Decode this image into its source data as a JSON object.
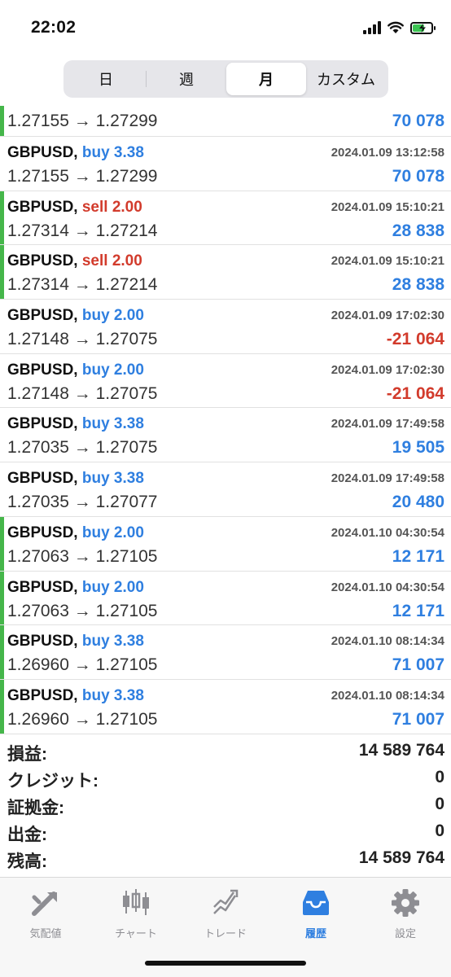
{
  "status": {
    "time": "22:02"
  },
  "segments": [
    "日",
    "週",
    "月",
    "カスタム"
  ],
  "first_row": {
    "prices": "1.27155 → 1.27299",
    "profit": "70 078",
    "profit_color": "#2f7fe0",
    "bar_color": "#45b64a"
  },
  "trades": [
    {
      "symbol": "GBPUSD,",
      "side": "buy 3.38",
      "side_color": "#2f7fe0",
      "time": "2024.01.09 13:12:58",
      "prices": "1.27155 → 1.27299",
      "profit": "70 078",
      "profit_color": "#2f7fe0",
      "bar_color": ""
    },
    {
      "symbol": "GBPUSD,",
      "side": "sell 2.00",
      "side_color": "#d23b2c",
      "time": "2024.01.09 15:10:21",
      "prices": "1.27314 → 1.27214",
      "profit": "28 838",
      "profit_color": "#2f7fe0",
      "bar_color": "#45b64a"
    },
    {
      "symbol": "GBPUSD,",
      "side": "sell 2.00",
      "side_color": "#d23b2c",
      "time": "2024.01.09 15:10:21",
      "prices": "1.27314 → 1.27214",
      "profit": "28 838",
      "profit_color": "#2f7fe0",
      "bar_color": "#45b64a"
    },
    {
      "symbol": "GBPUSD,",
      "side": "buy 2.00",
      "side_color": "#2f7fe0",
      "time": "2024.01.09 17:02:30",
      "prices": "1.27148 → 1.27075",
      "profit": "-21 064",
      "profit_color": "#d23b2c",
      "bar_color": ""
    },
    {
      "symbol": "GBPUSD,",
      "side": "buy 2.00",
      "side_color": "#2f7fe0",
      "time": "2024.01.09 17:02:30",
      "prices": "1.27148 → 1.27075",
      "profit": "-21 064",
      "profit_color": "#d23b2c",
      "bar_color": ""
    },
    {
      "symbol": "GBPUSD,",
      "side": "buy 3.38",
      "side_color": "#2f7fe0",
      "time": "2024.01.09 17:49:58",
      "prices": "1.27035 → 1.27075",
      "profit": "19 505",
      "profit_color": "#2f7fe0",
      "bar_color": ""
    },
    {
      "symbol": "GBPUSD,",
      "side": "buy 3.38",
      "side_color": "#2f7fe0",
      "time": "2024.01.09 17:49:58",
      "prices": "1.27035 → 1.27077",
      "profit": "20 480",
      "profit_color": "#2f7fe0",
      "bar_color": ""
    },
    {
      "symbol": "GBPUSD,",
      "side": "buy 2.00",
      "side_color": "#2f7fe0",
      "time": "2024.01.10 04:30:54",
      "prices": "1.27063 → 1.27105",
      "profit": "12 171",
      "profit_color": "#2f7fe0",
      "bar_color": "#45b64a"
    },
    {
      "symbol": "GBPUSD,",
      "side": "buy 2.00",
      "side_color": "#2f7fe0",
      "time": "2024.01.10 04:30:54",
      "prices": "1.27063 → 1.27105",
      "profit": "12 171",
      "profit_color": "#2f7fe0",
      "bar_color": "#45b64a"
    },
    {
      "symbol": "GBPUSD,",
      "side": "buy 3.38",
      "side_color": "#2f7fe0",
      "time": "2024.01.10 08:14:34",
      "prices": "1.26960 → 1.27105",
      "profit": "71 007",
      "profit_color": "#2f7fe0",
      "bar_color": "#45b64a"
    },
    {
      "symbol": "GBPUSD,",
      "side": "buy 3.38",
      "side_color": "#2f7fe0",
      "time": "2024.01.10 08:14:34",
      "prices": "1.26960 → 1.27105",
      "profit": "71 007",
      "profit_color": "#2f7fe0",
      "bar_color": "#45b64a"
    }
  ],
  "summary": {
    "profit_label": "損益:",
    "profit_value": "14 589 764",
    "credit_label": "クレジット:",
    "credit_value": "0",
    "deposit_label": "証拠金:",
    "deposit_value": "0",
    "withdrawal_label": "出金:",
    "withdrawal_value": "0",
    "balance_label": "残高:",
    "balance_value": "14 589 764"
  },
  "tabs": [
    {
      "label": "気配値",
      "icon": "quotes-icon"
    },
    {
      "label": "チャート",
      "icon": "chart-icon"
    },
    {
      "label": "トレード",
      "icon": "trade-icon"
    },
    {
      "label": "履歴",
      "icon": "history-icon"
    },
    {
      "label": "設定",
      "icon": "settings-icon"
    }
  ],
  "colors": {
    "accent": "#2f7fe0",
    "loss": "#d23b2c",
    "bar": "#45b64a"
  }
}
